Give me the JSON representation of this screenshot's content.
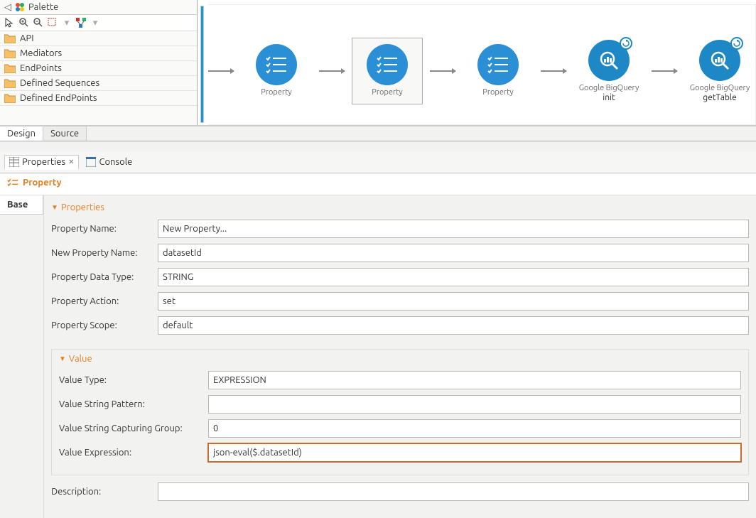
{
  "palette": {
    "title": "Palette",
    "items": [
      "API",
      "Mediators",
      "EndPoints",
      "Defined Sequences",
      "Defined EndPoints"
    ]
  },
  "flow": {
    "nodes": [
      {
        "label1": "Property",
        "label2": "",
        "type": "property"
      },
      {
        "label1": "Property",
        "label2": "",
        "type": "property",
        "selected": true
      },
      {
        "label1": "Property",
        "label2": "",
        "type": "property"
      },
      {
        "label1": "Google BigQuery",
        "label2": "init",
        "type": "connector"
      },
      {
        "label1": "Google BigQuery",
        "label2": "getTable",
        "type": "connector"
      }
    ]
  },
  "tabsDesignSource": {
    "design": "Design",
    "source": "Source"
  },
  "views": {
    "properties": "Properties",
    "console": "Console"
  },
  "heading": "Property",
  "sidebar": {
    "base": "Base"
  },
  "sections": {
    "properties": "Properties",
    "value": "Value"
  },
  "fields": {
    "propertyName": {
      "label": "Property Name:",
      "value": "New Property..."
    },
    "newPropertyName": {
      "label": "New Property Name:",
      "value": "datasetId"
    },
    "propertyDataType": {
      "label": "Property Data Type:",
      "value": "STRING"
    },
    "propertyAction": {
      "label": "Property Action:",
      "value": "set"
    },
    "propertyScope": {
      "label": "Property Scope:",
      "value": "default"
    },
    "valueType": {
      "label": "Value Type:",
      "value": "EXPRESSION"
    },
    "valueStringPattern": {
      "label": "Value String Pattern:",
      "value": ""
    },
    "valueStringCapturingGroup": {
      "label": "Value String Capturing Group:",
      "value": "0"
    },
    "valueExpression": {
      "label": "Value Expression:",
      "value": "json-eval($.datasetId)"
    },
    "description": {
      "label": "Description:",
      "value": ""
    }
  }
}
